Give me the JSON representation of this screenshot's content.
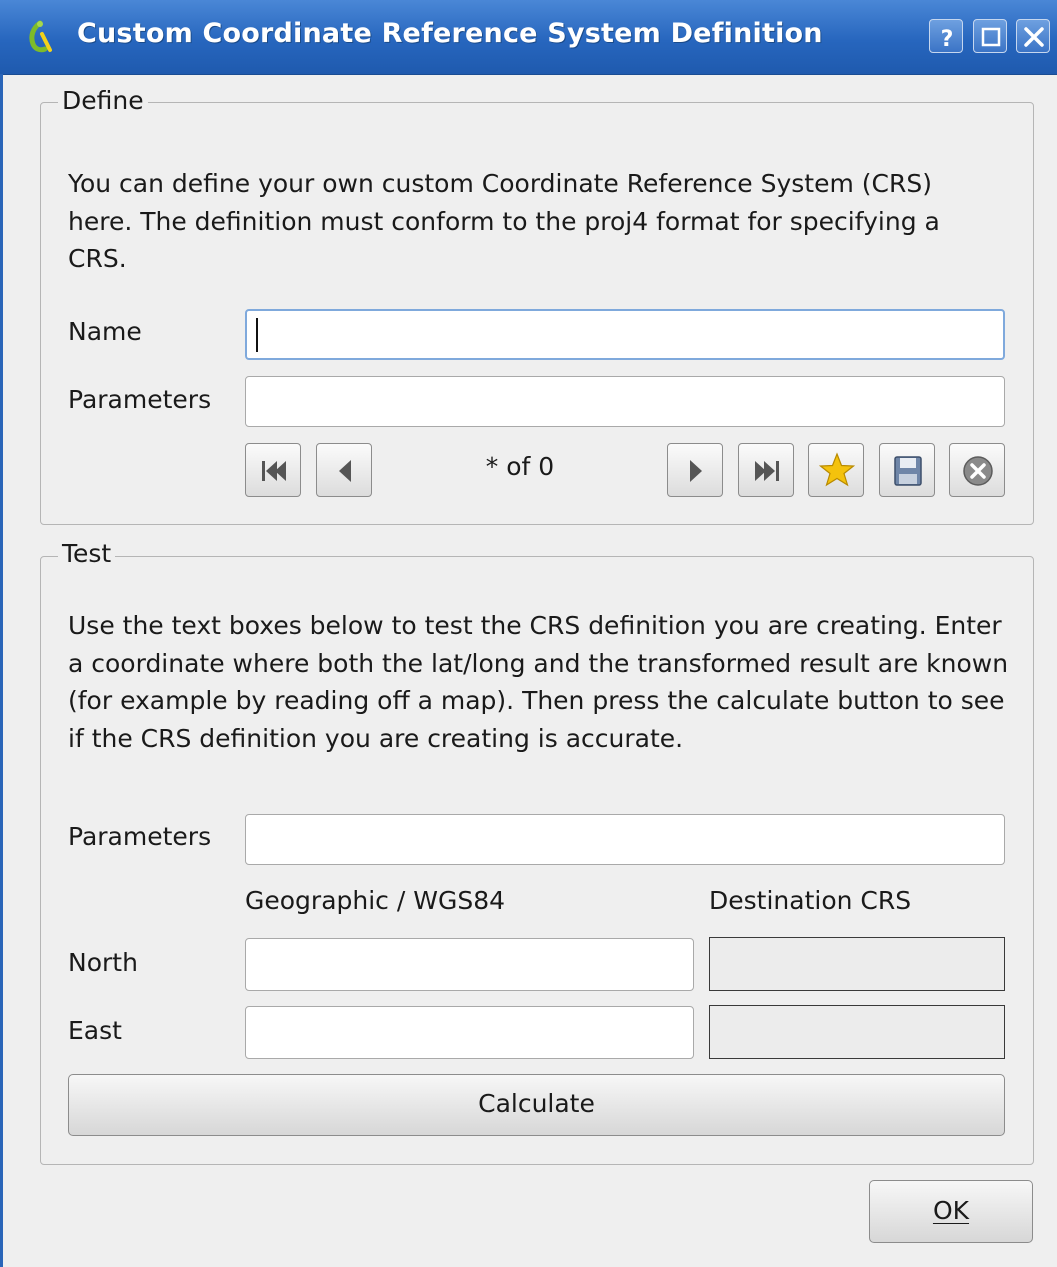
{
  "window": {
    "title": "Custom Coordinate Reference System Definition",
    "buttons": {
      "help": "?",
      "maximize": "□",
      "close": "✕"
    }
  },
  "define": {
    "legend": "Define",
    "description": "You can define your own custom Coordinate Reference System (CRS) here. The definition must conform to the proj4 format for specifying a CRS.",
    "name_label": "Name",
    "name_value": "",
    "parameters_label": "Parameters",
    "parameters_value": "",
    "record_counter": "* of 0",
    "nav_icons": [
      "first-icon",
      "previous-icon",
      "next-icon",
      "last-icon",
      "new-star-icon",
      "save-icon",
      "delete-icon"
    ]
  },
  "test": {
    "legend": "Test",
    "description": "Use the text boxes below to test the CRS definition you are creating. Enter a coordinate where both the lat/long and the transformed result are known (for example by reading off a map). Then press the calculate button to see if the CRS definition you are creating is accurate.",
    "parameters_label": "Parameters",
    "parameters_value": "",
    "col_geographic": "Geographic / WGS84",
    "col_destination": "Destination CRS",
    "north_label": "North",
    "east_label": "East",
    "north_value": "",
    "east_value": "",
    "dest_north_value": "",
    "dest_east_value": "",
    "calculate_label": "Calculate"
  },
  "footer": {
    "ok_label": "OK"
  },
  "colors": {
    "titlebar": "#2766be",
    "accent_star": "#f4c20d"
  }
}
